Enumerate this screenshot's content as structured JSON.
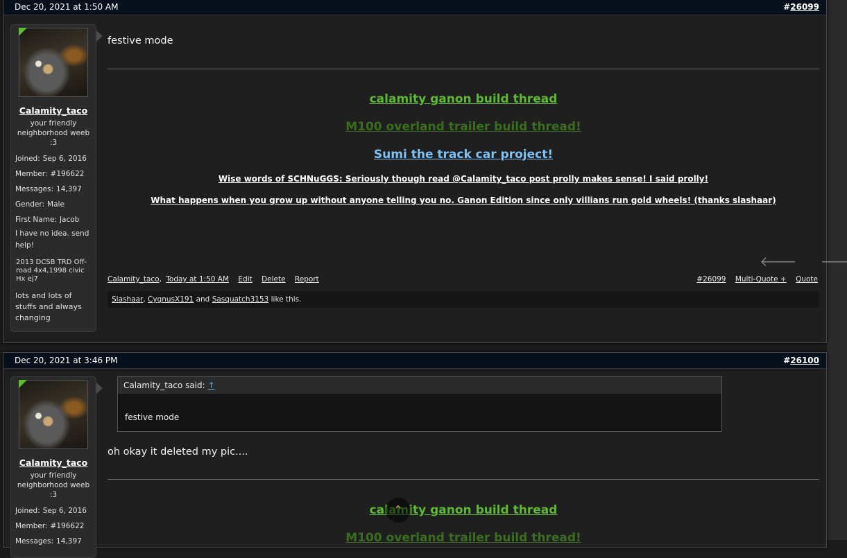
{
  "posts": [
    {
      "date": "Dec 20, 2021 at 1:50 AM",
      "number_hash": "#",
      "number": "26099",
      "user": {
        "name": "Calamity_taco",
        "title": "your friendly neighborhood weeb :3",
        "joined_label": "Joined:",
        "joined": "Sep 6, 2016",
        "member_label": "Member:",
        "member": "#196622",
        "messages_label": "Messages:",
        "messages": "14,397",
        "gender_label": "Gender:",
        "gender": "Male",
        "firstname_label": "First Name:",
        "firstname": "Jacob",
        "custom1": "I have no idea. send help!",
        "custom2": "2013 DCSB TRD Off-road 4x4,1998 civic Hx ej7",
        "custom3": "lots and lots of stuffs and always changing"
      },
      "message": "festive mode",
      "signature": [
        "calamity ganon build thread",
        "M100 overland trailer build thread!",
        "Sumi the track car project!",
        "Wise words of SCHNuGGS: Seriously though read @Calamity_taco post prolly makes sense! I said prolly!",
        "What happens when you grow up without anyone telling you no. Ganon Edition since only villians run gold wheels! (thanks slashaar)"
      ],
      "footer": {
        "author": "Calamity_taco",
        "sep": ",",
        "time": "Today at 1:50 AM",
        "edit": "Edit",
        "delete": "Delete",
        "report": "Report",
        "permalink": "#26099",
        "multiquote": "Multi-Quote +",
        "quote": "Quote"
      },
      "likes": {
        "user1": "Slashaar",
        "sep1": ",",
        "user2": "CygnusX191",
        "and": "and",
        "user3": "Sasquatch3153",
        "tail": "like this."
      }
    },
    {
      "date": "Dec 20, 2021 at 3:46 PM",
      "number_hash": "#",
      "number": "26100",
      "user": {
        "name": "Calamity_taco",
        "title": "your friendly neighborhood weeb :3",
        "joined_label": "Joined:",
        "joined": "Sep 6, 2016",
        "member_label": "Member:",
        "member": "#196622",
        "messages_label": "Messages:",
        "messages": "14,397"
      },
      "quote": {
        "author_said": "Calamity_taco said:",
        "up_arrow": "↑",
        "text": "festive mode"
      },
      "message": "oh okay it deleted my pic....",
      "signature": [
        "calamity ganon build thread",
        "M100 overland trailer build thread!"
      ]
    }
  ],
  "nav": {
    "prev_icon": "left-arrow-icon",
    "next_icon": "right-arrow-icon",
    "prev_glyph": "🡐",
    "next_glyph": "🡒"
  },
  "scroll_top_glyph": "⌃",
  "colors": {
    "header_bg": "#08101c",
    "link_green": "#5cb830",
    "link_dark_green": "#3a6e1e",
    "link_blue": "#7fc1f4"
  }
}
